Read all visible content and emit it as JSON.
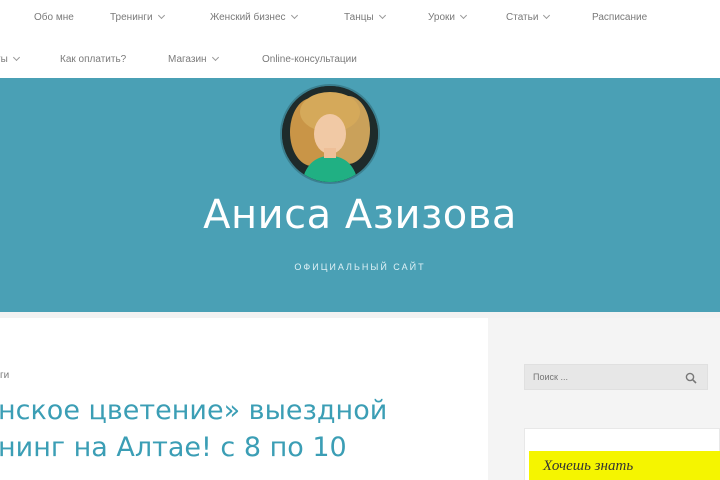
{
  "nav": {
    "row1": [
      {
        "label": "Обо мне",
        "has_dropdown": false
      },
      {
        "label": "Тренинги",
        "has_dropdown": true
      },
      {
        "label": "Женский бизнес",
        "has_dropdown": true
      },
      {
        "label": "Танцы",
        "has_dropdown": true
      },
      {
        "label": "Уроки",
        "has_dropdown": true
      },
      {
        "label": "Статьи",
        "has_dropdown": true
      },
      {
        "label": "Расписание",
        "has_dropdown": false
      }
    ],
    "row2": [
      {
        "label": "ты",
        "has_dropdown": true
      },
      {
        "label": "Как оплатить?",
        "has_dropdown": false
      },
      {
        "label": "Магазин",
        "has_dropdown": true
      },
      {
        "label": "Online-консультации",
        "has_dropdown": false
      }
    ]
  },
  "hero": {
    "site_title": "Аниса Азизова",
    "tagline": "ОФИЦИАЛЬНЫЙ САЙТ",
    "background_color": "#4aa0b5"
  },
  "content": {
    "category": "ги",
    "post_title_lines": [
      "нское цветение» выездной",
      "нинг на Алтае! с 8 по 10"
    ],
    "title_color": "#3b9eb5"
  },
  "sidebar": {
    "search_placeholder": "Поиск ...",
    "widget_text": "Хочешь знать",
    "widget_color": "#f5f500"
  },
  "icons": {
    "search": "search-icon",
    "dropdown": "chevron-down-icon"
  }
}
